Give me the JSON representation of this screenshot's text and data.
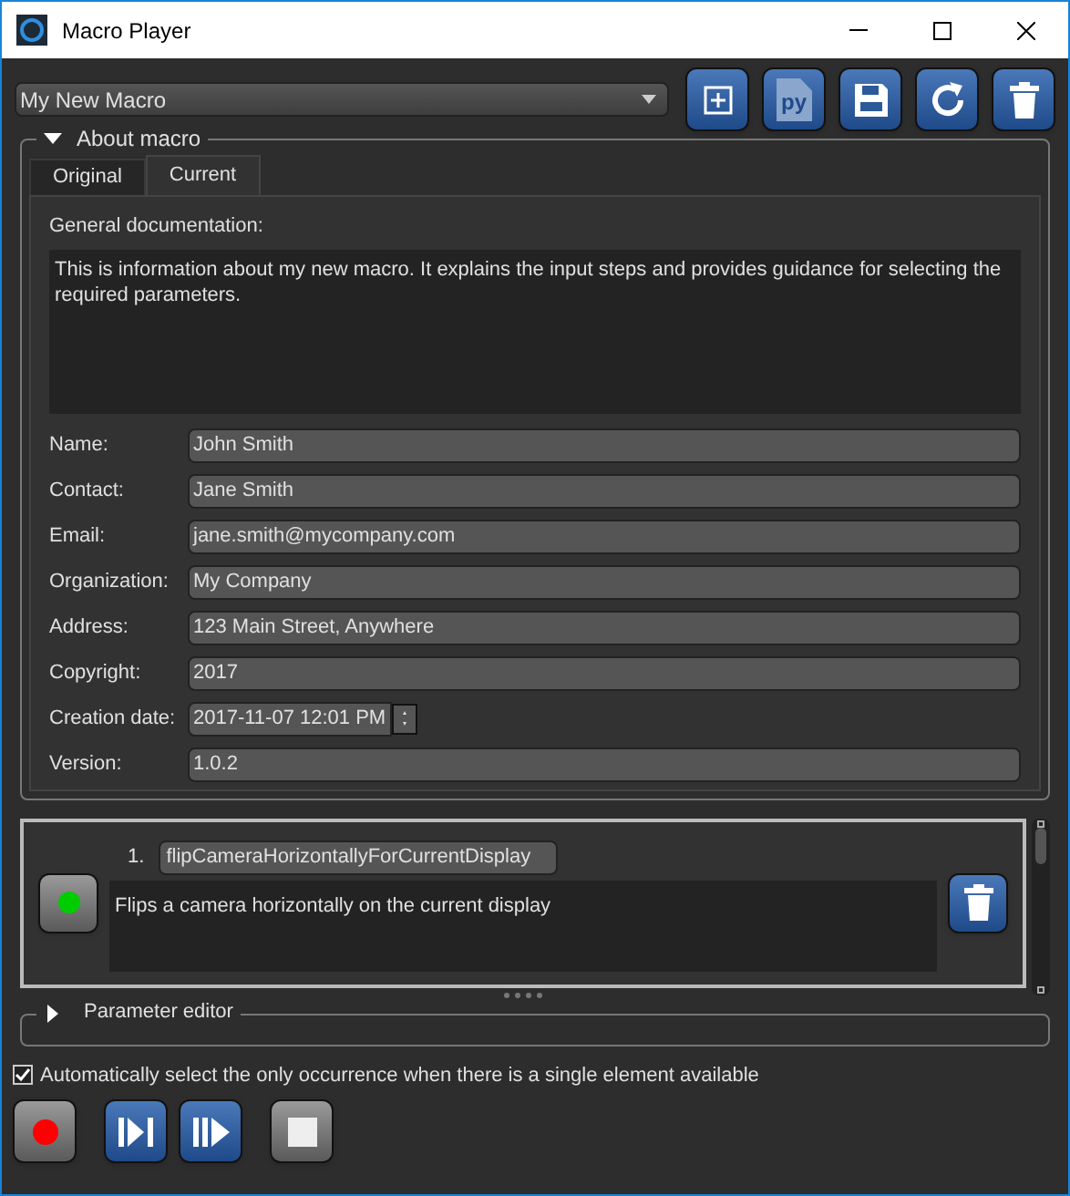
{
  "window": {
    "title": "Macro Player"
  },
  "macro_select": {
    "value": "My New Macro"
  },
  "toolbar": [
    {
      "kind": "add"
    },
    {
      "kind": "python",
      "label": "py"
    },
    {
      "kind": "save"
    },
    {
      "kind": "reload"
    },
    {
      "kind": "delete"
    }
  ],
  "about": {
    "title": "About macro",
    "expanded": true,
    "tabs": [
      {
        "label": "Original",
        "selected": false
      },
      {
        "label": "Current",
        "selected": true
      }
    ],
    "doc_label": "General documentation:",
    "doc_text": "This is information about my new macro. It explains the input steps and provides guidance for selecting the required parameters.",
    "fields": [
      {
        "label": "Name:",
        "value": "John Smith",
        "kind": "text"
      },
      {
        "label": "Contact:",
        "value": "Jane Smith",
        "kind": "text"
      },
      {
        "label": "Email:",
        "value": "jane.smith@mycompany.com",
        "kind": "text"
      },
      {
        "label": "Organization:",
        "value": "My Company",
        "kind": "text"
      },
      {
        "label": "Address:",
        "value": "123 Main Street, Anywhere",
        "kind": "text"
      },
      {
        "label": "Copyright:",
        "value": "2017",
        "kind": "text"
      },
      {
        "label": "Creation date:",
        "value": "2017-11-07 12:01 PM",
        "kind": "date"
      },
      {
        "label": "Version:",
        "value": "1.0.2",
        "kind": "text"
      }
    ]
  },
  "steps": [
    {
      "number": "1.",
      "name": "flipCameraHorizontallyForCurrentDisplay",
      "description": "Flips a camera horizontally on the current display",
      "selected": true
    }
  ],
  "parameter_editor": {
    "title": "Parameter editor",
    "expanded": false
  },
  "auto_select": {
    "label": "Automatically select the only occurrence when there is a single element available",
    "checked": true
  },
  "controls": [
    {
      "kind": "record"
    },
    {
      "kind": "step"
    },
    {
      "kind": "play"
    },
    {
      "kind": "stop"
    }
  ]
}
